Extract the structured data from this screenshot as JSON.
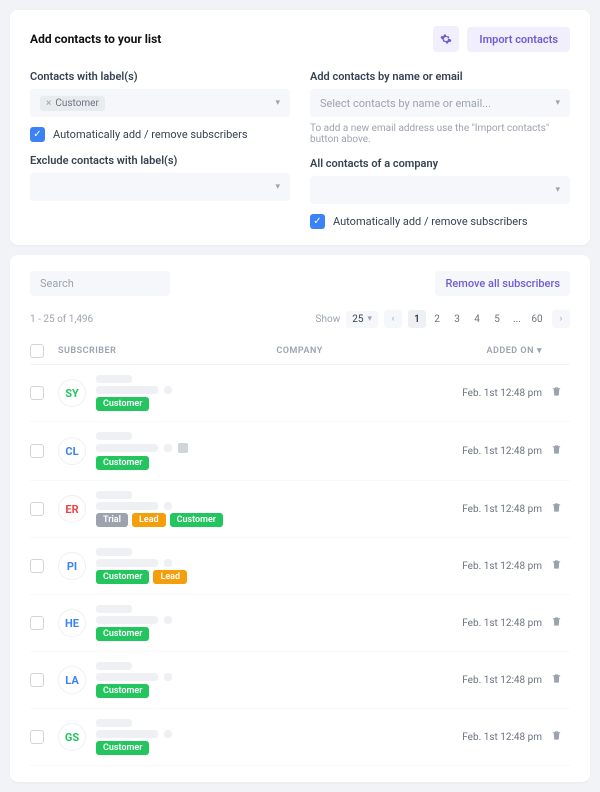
{
  "header": {
    "title": "Add contacts to your list",
    "import_label": "Import contacts"
  },
  "filters": {
    "contacts_with_label": "Contacts with label(s)",
    "customer_pill": "Customer",
    "auto_add_remove": "Automatically add / remove subscribers",
    "exclude_label": "Exclude contacts with label(s)",
    "by_name_label": "Add contacts by name or email",
    "by_name_placeholder": "Select contacts by name or email...",
    "by_name_helper": "To add a new email address use the \"Import contacts\" button above.",
    "company_label": "All contacts of a company",
    "company_auto": "Automatically add / remove subscribers"
  },
  "list": {
    "search_placeholder": "Search",
    "remove_all": "Remove all subscribers",
    "range": "1 - 25 of 1,496",
    "show_label": "Show",
    "show_value": "25",
    "pages": [
      "1",
      "2",
      "3",
      "4",
      "5",
      "...",
      "60"
    ],
    "th_subscriber": "SUBSCRIBER",
    "th_company": "COMPANY",
    "th_added": "ADDED ON"
  },
  "rows": [
    {
      "initials": "SY",
      "color": "#22c55e",
      "tags": [
        "Customer"
      ],
      "date": "Feb. 1st 12:48 pm",
      "note": false
    },
    {
      "initials": "CL",
      "color": "#3b82f6",
      "tags": [
        "Customer"
      ],
      "date": "Feb. 1st 12:48 pm",
      "note": true
    },
    {
      "initials": "ER",
      "color": "#ef4444",
      "tags": [
        "Trial",
        "Lead",
        "Customer"
      ],
      "date": "Feb. 1st 12:48 pm",
      "note": false
    },
    {
      "initials": "PI",
      "color": "#3b82f6",
      "tags": [
        "Customer",
        "Lead"
      ],
      "date": "Feb. 1st 12:48 pm",
      "note": false
    },
    {
      "initials": "HE",
      "color": "#3b82f6",
      "tags": [
        "Customer"
      ],
      "date": "Feb. 1st 12:48 pm",
      "note": false
    },
    {
      "initials": "LA",
      "color": "#3b82f6",
      "tags": [
        "Customer"
      ],
      "date": "Feb. 1st 12:48 pm",
      "note": false
    },
    {
      "initials": "GS",
      "color": "#22c55e",
      "tags": [
        "Customer"
      ],
      "date": "Feb. 1st 12:48 pm",
      "note": false
    }
  ]
}
